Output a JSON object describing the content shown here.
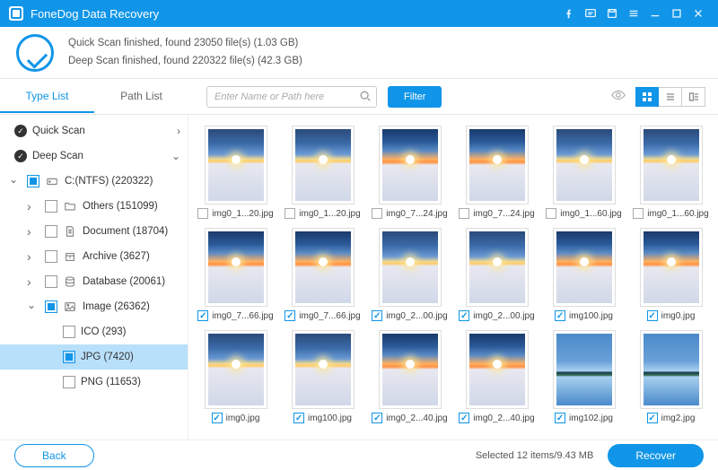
{
  "app": {
    "title": "FoneDog Data Recovery"
  },
  "status": {
    "line1": "Quick Scan finished, found 23050 file(s) (1.03 GB)",
    "line2": "Deep Scan finished, found 220322 file(s) (42.3 GB)"
  },
  "tabs": {
    "typeList": "Type List",
    "pathList": "Path List"
  },
  "search": {
    "placeholder": "Enter Name or Path here"
  },
  "filter": {
    "label": "Filter"
  },
  "tree": {
    "quickScan": "Quick Scan",
    "deepScan": "Deep Scan",
    "drive": "C:(NTFS) (220322)",
    "others": "Others (151099)",
    "document": "Document (18704)",
    "archive": "Archive (3627)",
    "database": "Database (20061)",
    "image": "Image (26362)",
    "ico": "ICO (293)",
    "jpg": "JPG (7420)",
    "png": "PNG (11653)"
  },
  "files": [
    {
      "name": "img0_1...20.jpg",
      "checked": false,
      "variant": "a"
    },
    {
      "name": "img0_1...20.jpg",
      "checked": false,
      "variant": "a"
    },
    {
      "name": "img0_7...24.jpg",
      "checked": false,
      "variant": "b"
    },
    {
      "name": "img0_7...24.jpg",
      "checked": false,
      "variant": "b"
    },
    {
      "name": "img0_1...60.jpg",
      "checked": false,
      "variant": "a"
    },
    {
      "name": "img0_1...60.jpg",
      "checked": false,
      "variant": "a"
    },
    {
      "name": "img0_7...66.jpg",
      "checked": true,
      "variant": "b"
    },
    {
      "name": "img0_7...66.jpg",
      "checked": true,
      "variant": "b"
    },
    {
      "name": "img0_2...00.jpg",
      "checked": true,
      "variant": "a"
    },
    {
      "name": "img0_2...00.jpg",
      "checked": true,
      "variant": "a"
    },
    {
      "name": "img100.jpg",
      "checked": true,
      "variant": "b"
    },
    {
      "name": "img0.jpg",
      "checked": true,
      "variant": "b"
    },
    {
      "name": "img0.jpg",
      "checked": true,
      "variant": "a"
    },
    {
      "name": "img100.jpg",
      "checked": true,
      "variant": "a"
    },
    {
      "name": "img0_2...40.jpg",
      "checked": true,
      "variant": "b"
    },
    {
      "name": "img0_2...40.jpg",
      "checked": true,
      "variant": "b"
    },
    {
      "name": "img102.jpg",
      "checked": true,
      "variant": "island"
    },
    {
      "name": "img2.jpg",
      "checked": true,
      "variant": "island"
    }
  ],
  "footer": {
    "back": "Back",
    "status": "Selected 12 items/9.43 MB",
    "recover": "Recover"
  }
}
